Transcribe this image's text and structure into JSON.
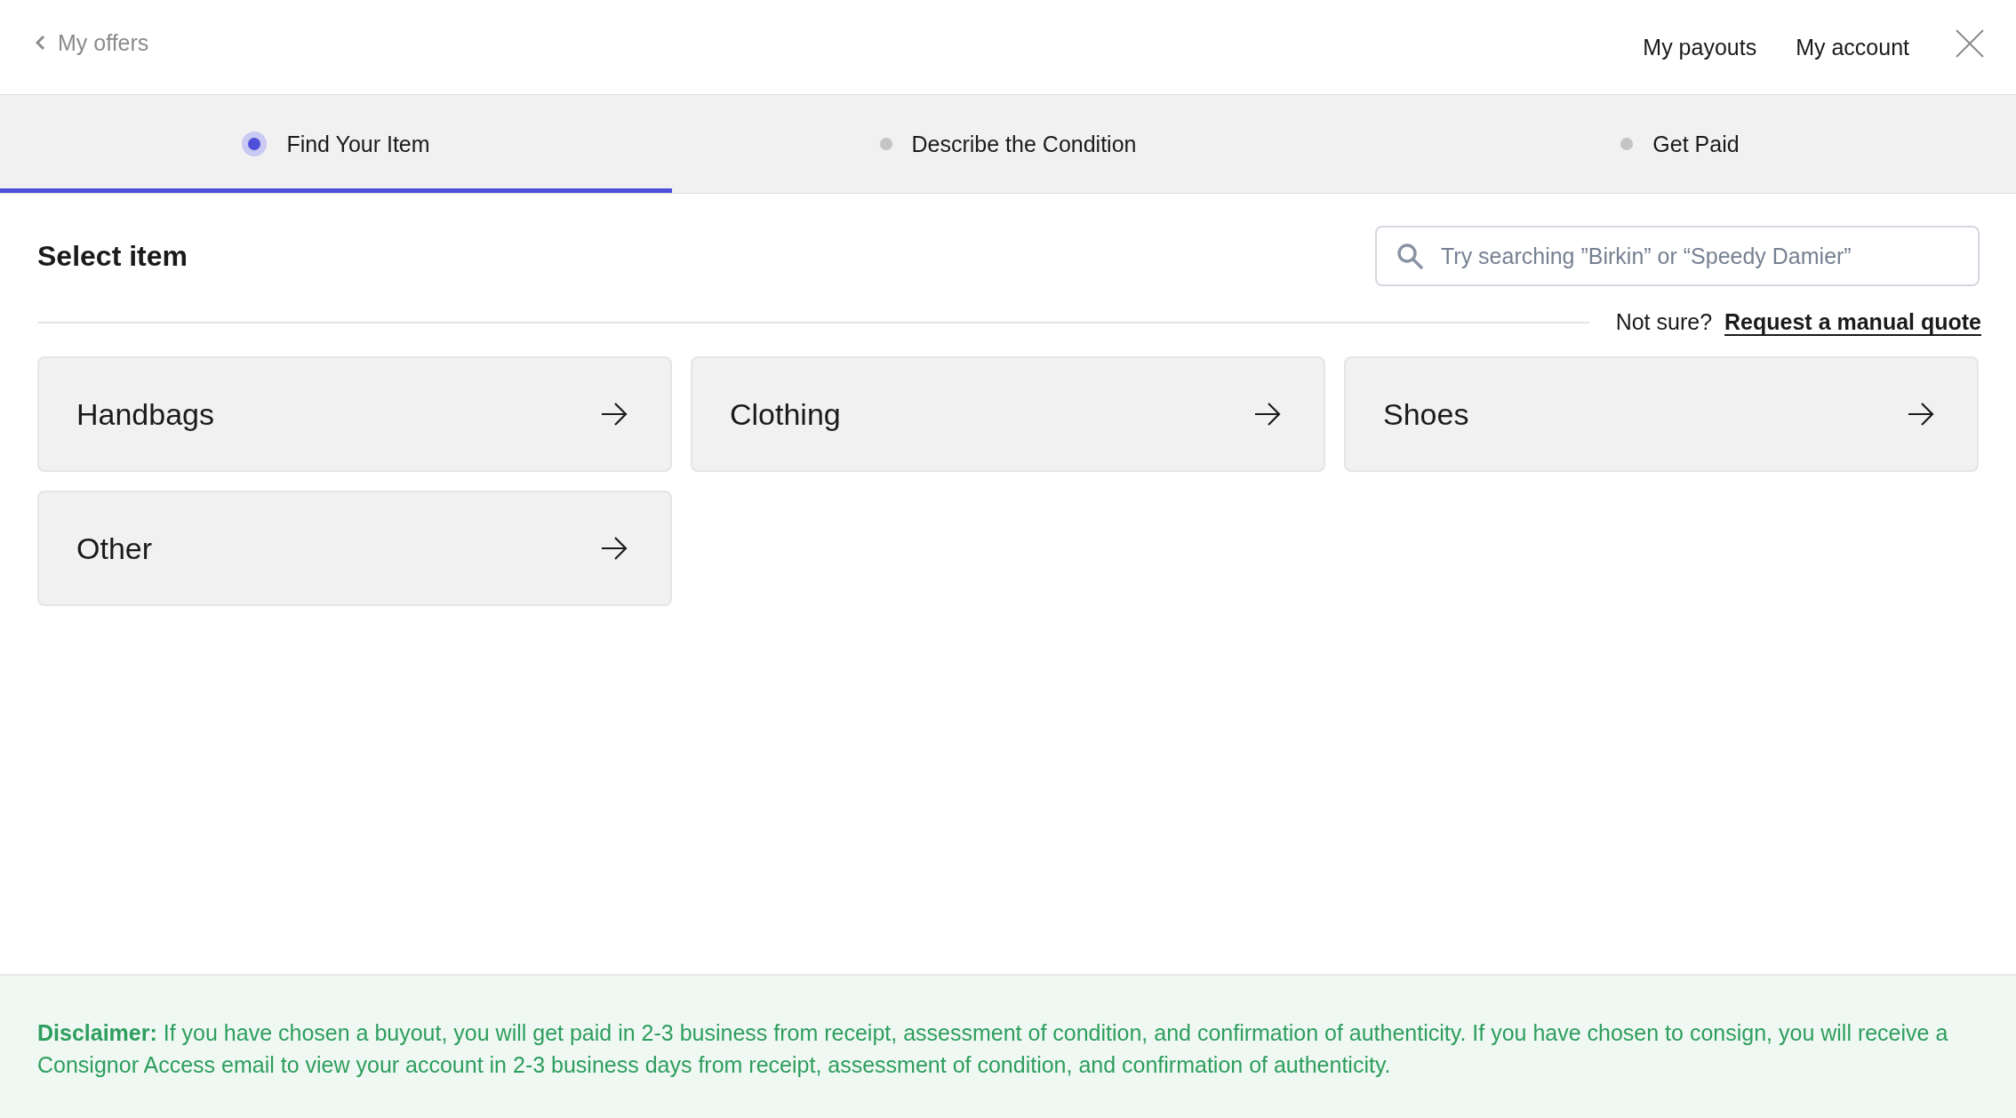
{
  "header": {
    "back_link": "My offers",
    "nav": [
      "My payouts",
      "My account"
    ]
  },
  "steps": [
    {
      "label": "Find Your Item",
      "selected": true
    },
    {
      "label": "Describe the Condition",
      "selected": false
    },
    {
      "label": "Get Paid",
      "selected": false
    }
  ],
  "heading": "Select item",
  "search": {
    "placeholder": "Try searching ”Birkin” or “Speedy Damier”"
  },
  "help": {
    "text": "Not sure?",
    "link": "Request a manual quote"
  },
  "categories": [
    "Handbags",
    "Clothing",
    "Shoes",
    "Other"
  ],
  "disclaimer": "**Disclaimer:** If you have chosen a buyout, you will get paid in 2-3 business from receipt, assessment of condition, and confirmation of authenticity. If you have chosen to consign, you will receive a Consignor Access email to view your account in 2-3 business days from receipt, assessment of condition, and confirmation of authenticity."
}
